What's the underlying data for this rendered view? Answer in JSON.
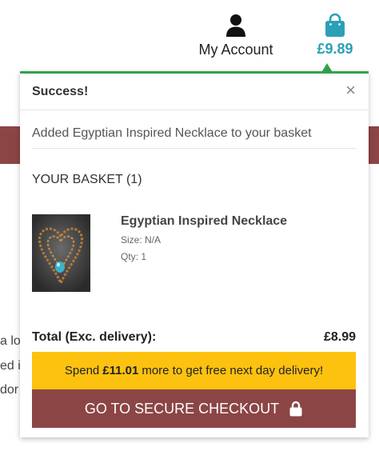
{
  "header": {
    "account_label": "My Account",
    "account_icon": "user-icon",
    "basket_total": "£9.89",
    "basket_icon": "shopping-bag-icon",
    "accent_color": "#2aa0b6"
  },
  "background": {
    "text_lines": [
      "a lo",
      "ed i",
      "dor"
    ]
  },
  "popup": {
    "title": "Success!",
    "close_label": "×",
    "added_message": "Added Egyptian Inspired Necklace to your basket",
    "basket_heading": "YOUR BASKET (1)",
    "item": {
      "name": "Egyptian Inspired Necklace",
      "size": "Size: N/A",
      "qty": "Qty: 1"
    },
    "total_label": "Total (Exc. delivery):",
    "total_value": "£8.99",
    "promo": {
      "prefix": "Spend",
      "amount": "£11.01",
      "suffix": "more to get free next day delivery!"
    },
    "checkout_label": "GO TO SECURE CHECKOUT",
    "checkout_icon": "lock-icon",
    "colors": {
      "success": "#33a24a",
      "promo": "#fdc20f",
      "checkout": "#8b4545"
    }
  }
}
